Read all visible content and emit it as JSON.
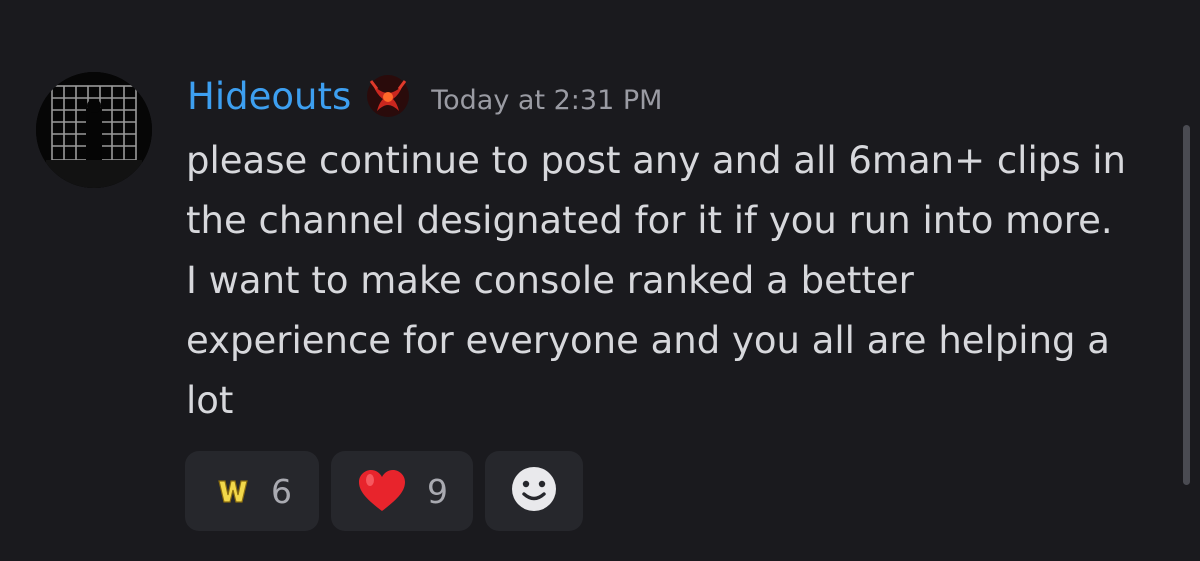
{
  "message": {
    "author": "Hideouts",
    "timestamp": "Today at 2:31 PM",
    "content_lines": [
      "please continue to post any and all 6man+ clips in",
      "the channel designated for it if you run into more.",
      "I want to make console ranked a better",
      "experience for everyone and you all are helping a",
      "lot"
    ]
  },
  "reactions": [
    {
      "emoji": "w-emoji",
      "count": "6"
    },
    {
      "emoji": "red-heart-emoji",
      "count": "9"
    }
  ],
  "add_reaction_icon": "smiley-face-icon",
  "colors": {
    "background": "#1a1a1e",
    "username": "#3d9ff0",
    "timestamp": "#9a9ba3",
    "message_text": "#d7d8dc",
    "reaction_bg": "#26272c"
  }
}
